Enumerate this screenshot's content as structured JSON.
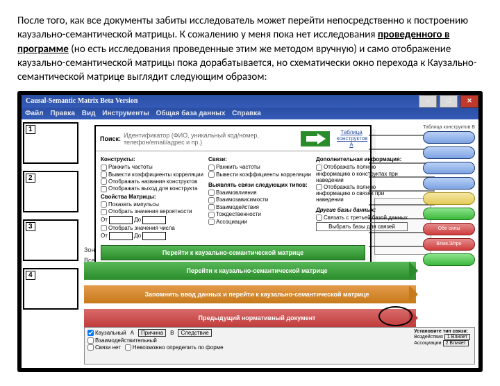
{
  "intro": {
    "t1": "После того, как все документы забиты исследователь может перейти непосредственно к построению каузально-семантической матрицы. К сожалению у меня пока нет исследования ",
    "u1": "проведенного в программе",
    "t2": " (но есть исследования проведенные этим же методом вручную) и само отображение каузально-семантической матрицы пока дорабатывается, но схематически окно перехода к Каузально-семантической матрице выглядит следующим образом:"
  },
  "window": {
    "title": "Causal-Semantic Matrix Beta Version",
    "menu": [
      "Файл",
      "Правка",
      "Вид",
      "Инструменты",
      "Общая база данных",
      "Справка"
    ]
  },
  "dialog": {
    "search_label": "Поиск:",
    "search_hint": "Идентификатор (ФИО, уникальный код/номер, телефон/email/адрес и пр.)",
    "tab_a": "Таблица конструктов А",
    "tab_b": "Таблица конструктов В",
    "col1": {
      "h": "Конструкты:",
      "items": [
        "Ранжить частоты",
        "Вывести коэффициенты корреляции",
        "Отображать названия конструктов",
        "Отображать выход для конструкта"
      ],
      "h2": "Свойства Матрицы:",
      "items2": [
        "Показать импульсы",
        "Отобрать значения вероятности"
      ],
      "from": "От",
      "to": "До",
      "add": "Отобрать значения числа",
      "from2": "От",
      "to2": "До"
    },
    "col2": {
      "h": "Связи:",
      "items": [
        "Ранжить частоты",
        "Вывести коэффициенты корреляции"
      ],
      "h2": "Выявлять связи следующих типов:",
      "types": [
        "Взаимовлияния",
        "Взаимозависимости",
        "Взаимодействия",
        "Тождественности",
        "Ассоциации"
      ]
    },
    "col3": {
      "h": "Дополнительная информация:",
      "items": [
        "Отображать полную информацию о конструктах при наведении",
        "Отображать полную информацию о связях при наведении"
      ],
      "h2": "Другие базы данных:",
      "ext": "Связать с третьей базой данных",
      "select": "Выбрать базы для связей"
    },
    "go_btn": "Перейти к каузально-семантической матрице"
  },
  "right_pills": {
    "hint": "Таблица конструктов В",
    "red1": "Обе силы",
    "red2": "Влия.З/про"
  },
  "left": {
    "zone": "Зона д",
    "all": "Все т"
  },
  "bottom_arrows": {
    "green": "Перейти к каузально-семантической матрице",
    "orange": "Запомнить ввод данных и перейти к каузально-семантической матрице",
    "red": "Предыдущий нормативный документ"
  },
  "bottom_panel": {
    "title": "Установите тип связи:",
    "row1": [
      "Каузальный",
      "А",
      "Причина",
      "В",
      "Следствие"
    ],
    "row2": [
      "Взаимодействительный"
    ],
    "row3": [
      "Связи нет",
      "Невозможно определить по форме"
    ],
    "r_label1": "Воздействия",
    "r_label2": "Ассоциации",
    "btn1": "1 Влияет",
    "btn2": "2 Влияет"
  }
}
